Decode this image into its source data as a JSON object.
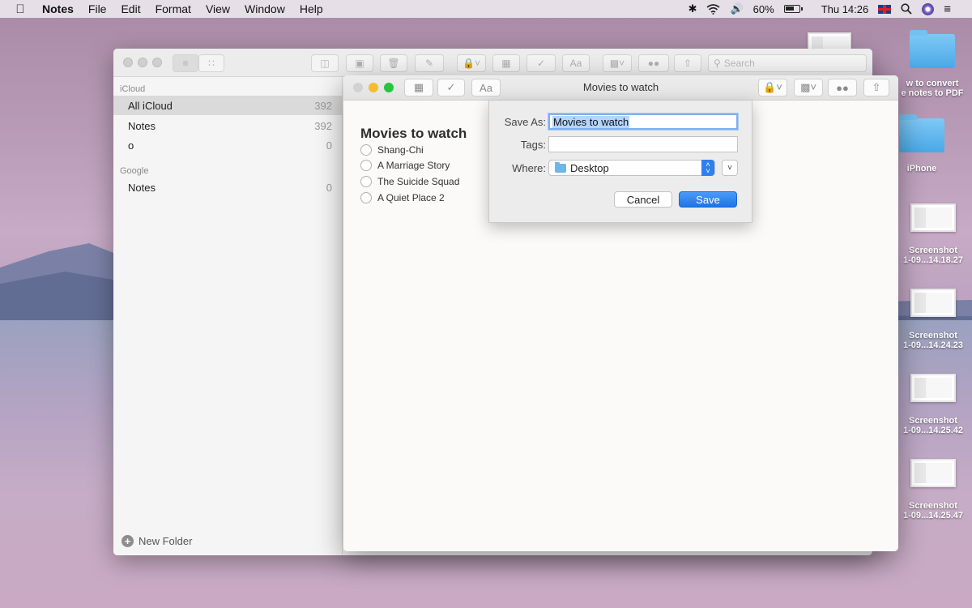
{
  "menubar": {
    "app_name": "Notes",
    "menus": [
      "File",
      "Edit",
      "Format",
      "View",
      "Window",
      "Help"
    ],
    "battery": "60%",
    "clock": "Thu 14:26"
  },
  "main_window": {
    "search_placeholder": "Search",
    "sections": [
      {
        "heading": "iCloud",
        "folders": [
          {
            "name": "All iCloud",
            "count": "392"
          },
          {
            "name": "Notes",
            "count": "392"
          },
          {
            "name": "o",
            "count": "0"
          }
        ]
      },
      {
        "heading": "Google",
        "folders": [
          {
            "name": "Notes",
            "count": "0"
          }
        ]
      }
    ],
    "new_folder_label": "New Folder",
    "font_button": "Aa"
  },
  "note_window": {
    "title": "Movies to watch",
    "font_button": "Aa",
    "note_heading": "Movies to watch",
    "checklist": [
      "Shang-Chi",
      "A Marriage Story",
      "The Suicide Squad",
      "A Quiet Place 2"
    ]
  },
  "save_sheet": {
    "save_as_label": "Save As:",
    "save_as_value": "Movies to watch",
    "tags_label": "Tags:",
    "tags_value": "",
    "where_label": "Where:",
    "where_value": "Desktop",
    "cancel_label": "Cancel",
    "save_label": "Save"
  },
  "desktop": {
    "folders": [
      {
        "label_line1": "w to convert",
        "label_line2": "e notes to PDF"
      },
      {
        "label_line1": "iPhone",
        "label_line2": ""
      }
    ],
    "screenshots": [
      {
        "label_line1": "Screenshot",
        "label_line2": "1-09...14.18.27"
      },
      {
        "label_line1": "Screenshot",
        "label_line2": "1-09...14.24.23"
      },
      {
        "label_line1": "Screenshot",
        "label_line2": "1-09...14.25.42"
      },
      {
        "label_line1": "Screenshot",
        "label_line2": "1-09...14.25.47"
      }
    ]
  }
}
